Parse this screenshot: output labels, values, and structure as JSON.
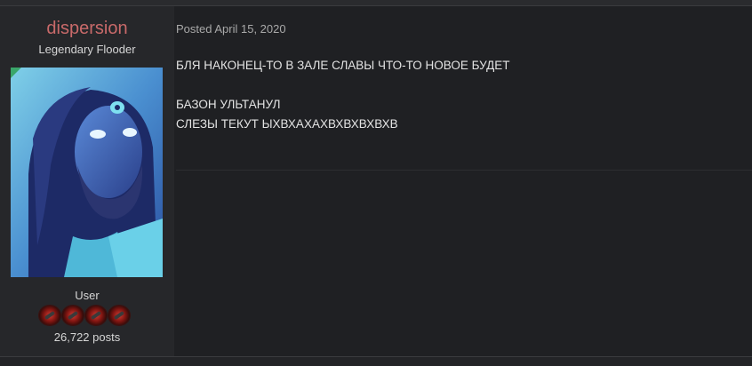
{
  "author": {
    "username": "dispersion",
    "title": "Legendary Flooder",
    "group": "User",
    "post_count": "26,722 posts",
    "avatar_icon": "avatar-portrait-icon",
    "rank_badges": 4
  },
  "post": {
    "meta": "Posted April 15, 2020",
    "lines": [
      "БЛЯ НАКОНЕЦ-ТО В ЗАЛЕ СЛАВЫ ЧТО-ТО НОВОЕ БУДЕТ",
      "",
      "БАЗОН УЛЬТАНУЛ",
      "СЛЕЗЫ ТЕКУТ ЫХВХАХАХВХВХВХВХВ"
    ]
  },
  "colors": {
    "username": "#c96a6a",
    "online": "#3aa66a",
    "background": "#1f2023",
    "author_pane": "#26272a"
  }
}
